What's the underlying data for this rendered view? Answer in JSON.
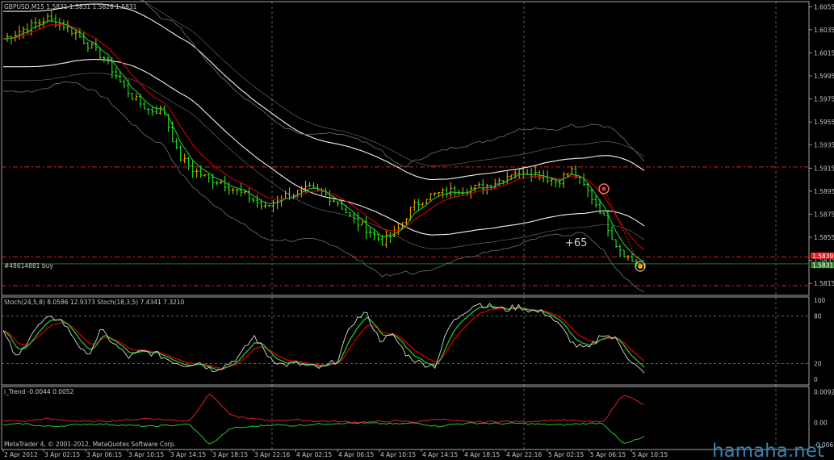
{
  "main_header": "GBPUSD,M15  1.5831 1.5831 1.5828 1.5831",
  "stoch_header": "Stoch(24,5,8) 8.0586 12.9373   Stoch(18,3,5) 7.4341 7.3210",
  "trend_header": "i_Trend -0.0044 0.0052",
  "footer": "MetaTrader 4, © 2001-2012, MetaQuotes Software Corp.",
  "watermark": "hamaha.net",
  "order_label": "#48614881 buy",
  "annotation": "+65",
  "colors": {
    "background": "#000000",
    "frame": "#cfcfcf",
    "grid": "#6e8e6e",
    "bull_candle": "#ffb000",
    "bear_candle": "#29ff29",
    "envelope": "#ffffff",
    "bollinger": "#5a6e5a",
    "ma_fast": "#2ac22a",
    "ma_red": "#c40000",
    "level_line": "#e02020",
    "price_tag": "#2a7a2a"
  },
  "chart_data": [
    {
      "type": "candlestick",
      "title": "GBPUSD,M15",
      "ohlc_current": {
        "open": 1.5831,
        "high": 1.5831,
        "low": 1.5828,
        "close": 1.5831
      },
      "y_ticks": [
        "1.6055",
        "1.6035",
        "1.6015",
        "1.5995",
        "1.5975",
        "1.5955",
        "1.5935",
        "1.5915",
        "1.5895",
        "1.5875",
        "1.5855",
        "1.5835",
        "1.5815"
      ],
      "ylim": [
        1.5806,
        1.6058
      ],
      "x_ticks": [
        "2 Apr 2012",
        "3 Apr 02:15",
        "3 Apr 06:15",
        "3 Apr 10:15",
        "3 Apr 14:15",
        "3 Apr 18:15",
        "3 Apr 22:16",
        "4 Apr 02:15",
        "4 Apr 06:15",
        "4 Apr 10:15",
        "4 Apr 14:15",
        "4 Apr 18:15",
        "4 Apr 22:16",
        "5 Apr 02:15",
        "5 Apr 06:15",
        "5 Apr 10:15"
      ],
      "price_tags": [
        "1.5839",
        "1.5831"
      ],
      "horizontal_levels": [
        1.5916,
        1.5838,
        1.5832,
        1.5813
      ],
      "series": [
        {
          "kind": "candles",
          "values": [
            1.6027,
            1.6033,
            1.6039,
            1.6045,
            1.604,
            1.6032,
            1.602,
            1.601,
            1.599,
            1.5975,
            1.5965,
            1.5965,
            1.5926,
            1.5914,
            1.5906,
            1.5903,
            1.5895,
            1.5889,
            1.588,
            1.589,
            1.5893,
            1.5897,
            1.5893,
            1.5885,
            1.587,
            1.5862,
            1.5851,
            1.586,
            1.588,
            1.589,
            1.5893,
            1.5896,
            1.5897,
            1.5899,
            1.5904,
            1.5912,
            1.5912,
            1.5909,
            1.5903,
            1.5913,
            1.5897,
            1.5878,
            1.585,
            1.5836,
            1.5829
          ]
        },
        {
          "kind": "moving-average",
          "color": "ma_fast"
        },
        {
          "kind": "moving-average",
          "color": "ma_red"
        },
        {
          "kind": "envelope",
          "color": "envelope"
        },
        {
          "kind": "bollinger",
          "color": "bollinger"
        }
      ]
    },
    {
      "type": "line",
      "title": "Stoch(24,5,8)  Stoch(18,3,5)",
      "values_current": {
        "stoch1_main": 8.0586,
        "stoch1_signal": 12.9373,
        "stoch2_main": 7.4341,
        "stoch2_signal": 7.321
      },
      "y_ticks": [
        "100",
        "80",
        "20",
        "0"
      ],
      "ylim": [
        0,
        100
      ],
      "levels": [
        80,
        20
      ],
      "series": [
        {
          "color": "#d8d8d8",
          "values": [
            60,
            25,
            58,
            75,
            78,
            55,
            28,
            62,
            44,
            28,
            35,
            32,
            24,
            18,
            22,
            12,
            18,
            30,
            55,
            30,
            18,
            20,
            16,
            14,
            25,
            70,
            85,
            50,
            55,
            30,
            20,
            17,
            67,
            85,
            96,
            92,
            88,
            92,
            86,
            84,
            66,
            43,
            38,
            58,
            50,
            24,
            6
          ]
        },
        {
          "color": "#2ac22a"
        },
        {
          "color": "#c40000"
        }
      ]
    },
    {
      "type": "line",
      "title": "i_Trend",
      "values_current": {
        "value1": -0.0044,
        "value2": 0.0052
      },
      "y_ticks": [
        "0.0092",
        "0.00",
        "-0.0067"
      ],
      "ylim": [
        -0.0072,
        0.0098
      ],
      "series": [
        {
          "color": "#e02020",
          "values": [
            0.0005,
            0.0003,
            0.0011,
            0.0006,
            0.0002,
            0.0004,
            0.0007,
            0.0012,
            0.0007,
            0.0004,
            0.0088,
            0.002,
            0.0011,
            0.0005,
            0.0008,
            0.0004,
            0.0003,
            0.0001,
            0.0002,
            0.0004,
            0.0001,
            0.0011,
            0.0003,
            0.0001,
            0.0003,
            0.0002,
            0.0005,
            0.0007,
            0.0003,
            0.0001,
            0.0086,
            0.0052
          ]
        },
        {
          "color": "#2ac22a",
          "values": [
            -0.0008,
            -0.0004,
            -0.0012,
            -0.001,
            -0.0005,
            -0.0006,
            -0.0009,
            -0.0012,
            -0.0009,
            -0.0006,
            -0.0068,
            -0.0018,
            -0.0013,
            -0.0007,
            -0.001,
            -0.0006,
            -0.0003,
            -0.0002,
            -0.0003,
            -0.0005,
            -0.0002,
            -0.0012,
            -0.0004,
            -0.0002,
            -0.0004,
            -0.0003,
            -0.0006,
            -0.0008,
            -0.0004,
            -0.0002,
            -0.0066,
            -0.0044
          ]
        }
      ]
    }
  ]
}
